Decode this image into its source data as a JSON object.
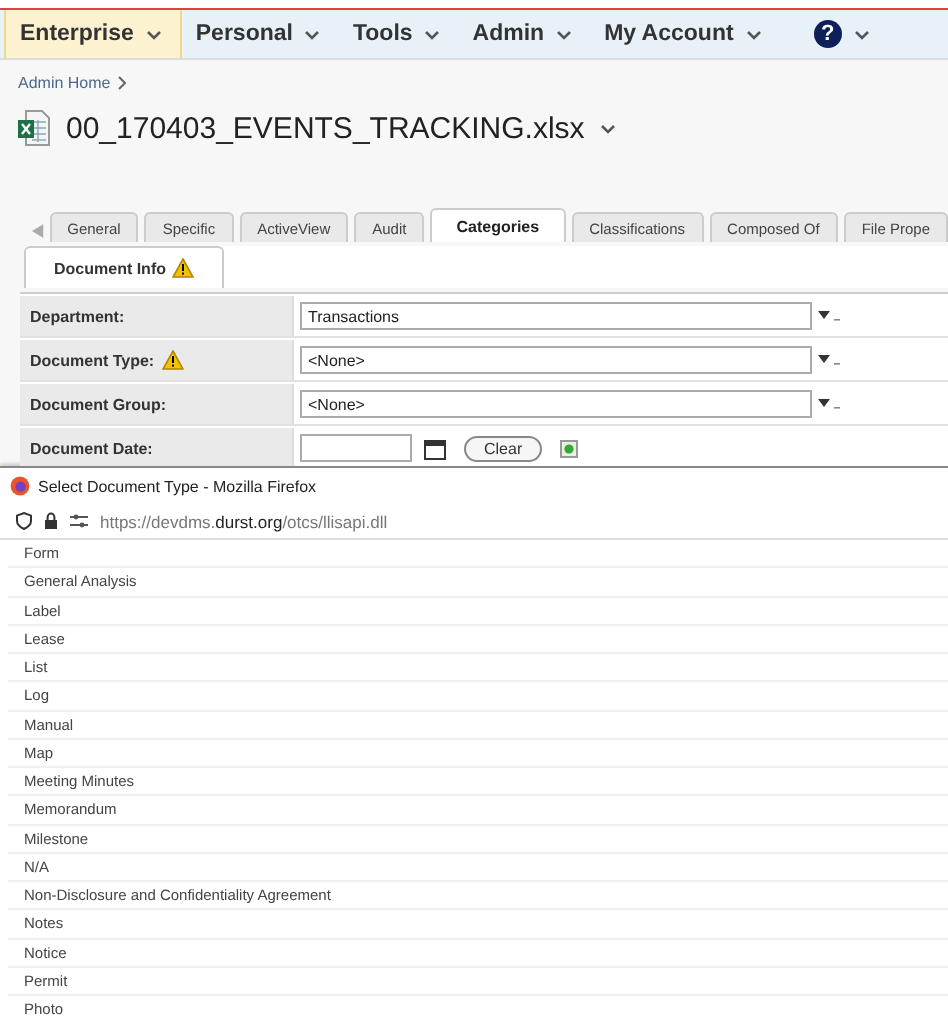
{
  "nav": {
    "items": [
      {
        "label": "Enterprise",
        "selected": true
      },
      {
        "label": "Personal",
        "selected": false
      },
      {
        "label": "Tools",
        "selected": false
      },
      {
        "label": "Admin",
        "selected": false
      },
      {
        "label": "My Account",
        "selected": false
      },
      {
        "label": "?",
        "selected": false
      }
    ]
  },
  "breadcrumb": "Admin Home",
  "document": {
    "title": "00_170403_EVENTS_TRACKING.xlsx"
  },
  "tabs": [
    {
      "label": "General",
      "selected": false
    },
    {
      "label": "Specific",
      "selected": false
    },
    {
      "label": "ActiveView",
      "selected": false
    },
    {
      "label": "Audit",
      "selected": false
    },
    {
      "label": "Categories",
      "selected": true
    },
    {
      "label": "Classifications",
      "selected": false
    },
    {
      "label": "Composed Of",
      "selected": false
    },
    {
      "label": "File Prope",
      "selected": false
    }
  ],
  "subtab": {
    "label": "Document Info",
    "warning": true
  },
  "form": {
    "rows": [
      {
        "kind": "select",
        "label": "Department:",
        "warning": false,
        "value": "Transactions"
      },
      {
        "kind": "select",
        "label": "Document Type:",
        "warning": true,
        "value": "<None>"
      },
      {
        "kind": "select",
        "label": "Document Group:",
        "warning": false,
        "value": "<None>"
      },
      {
        "kind": "date",
        "label": "Document Date:",
        "warning": false,
        "button": "Clear"
      }
    ]
  },
  "popup": {
    "title": "Select Document Type - Mozilla Firefox",
    "url": "https://devdms.**durst.org**/otcs/llisapi.dll",
    "items": [
      "Form",
      "General Analysis",
      "Label",
      "Lease",
      "List",
      "Log",
      "Manual",
      "Map",
      "Meeting Minutes",
      "Memorandum",
      "Milestone",
      "N/A",
      "Non-Disclosure and Confidentiality Agreement",
      "Notes",
      "Notice",
      "Permit",
      "Photo"
    ]
  }
}
